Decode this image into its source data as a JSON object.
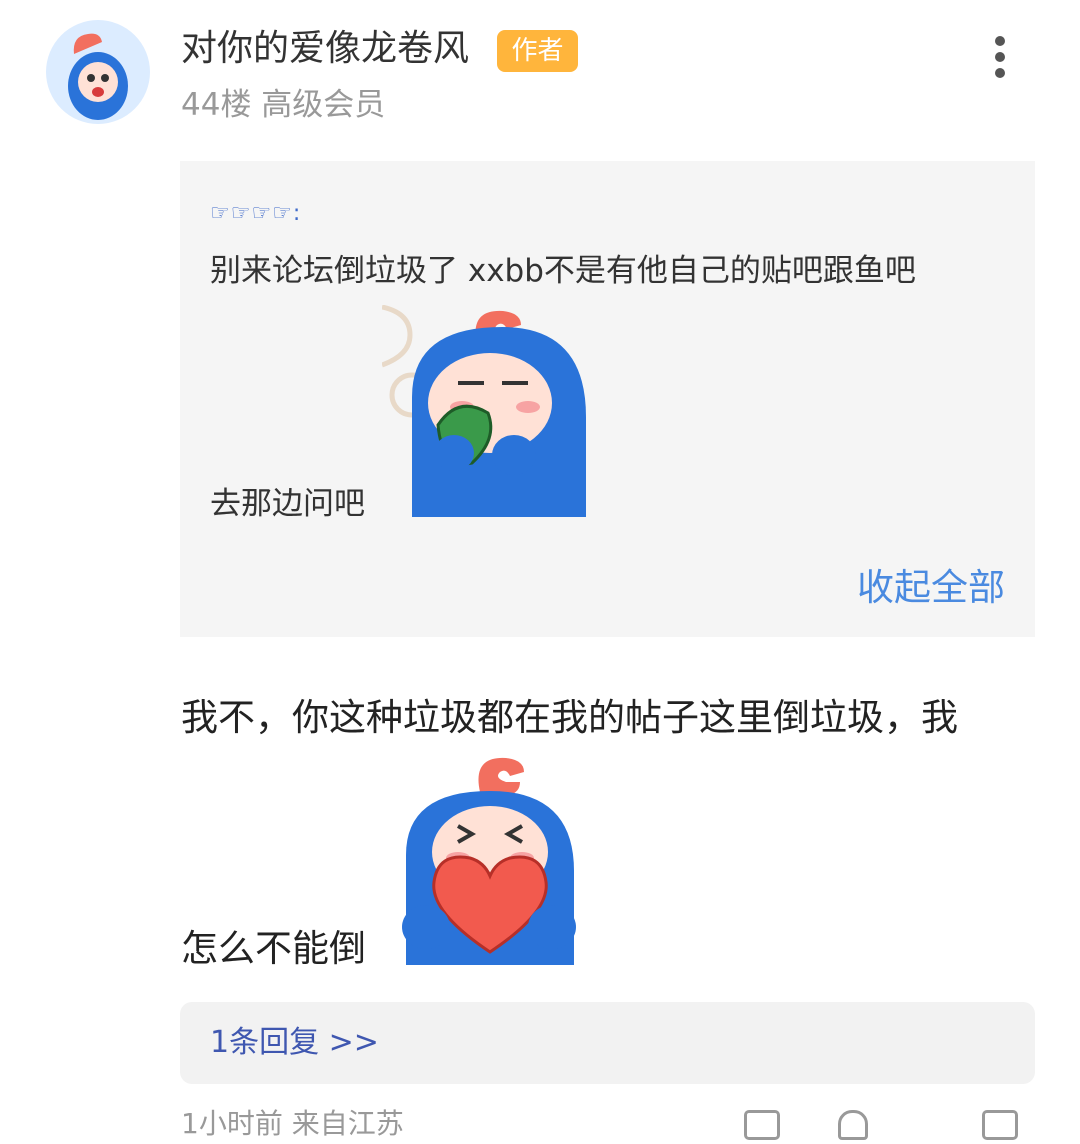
{
  "post": {
    "username": "对你的爱像龙卷风",
    "author_badge": "作者",
    "meta": "44楼 高级会员",
    "more_icon": "more-vertical-icon"
  },
  "quote": {
    "pointers": "☞☞☞☞:",
    "line1": "别来论坛倒垃圾了  xxbb不是有他自己的贴吧跟鱼吧",
    "line2": "去那边问吧",
    "collapse_label": "收起全部"
  },
  "reply": {
    "line1": "我不，你这种垃圾都在我的帖子这里倒垃圾，我",
    "line2": "怎么不能倒"
  },
  "sub_replies": {
    "label": "1条回复 >>"
  },
  "footer": {
    "time_location": "1小时前 来自江苏"
  },
  "colors": {
    "badge": "#ffb53c",
    "link": "#4a8ae0",
    "subreply_link": "#3f57b0",
    "mascot_blue": "#2a73d9"
  }
}
